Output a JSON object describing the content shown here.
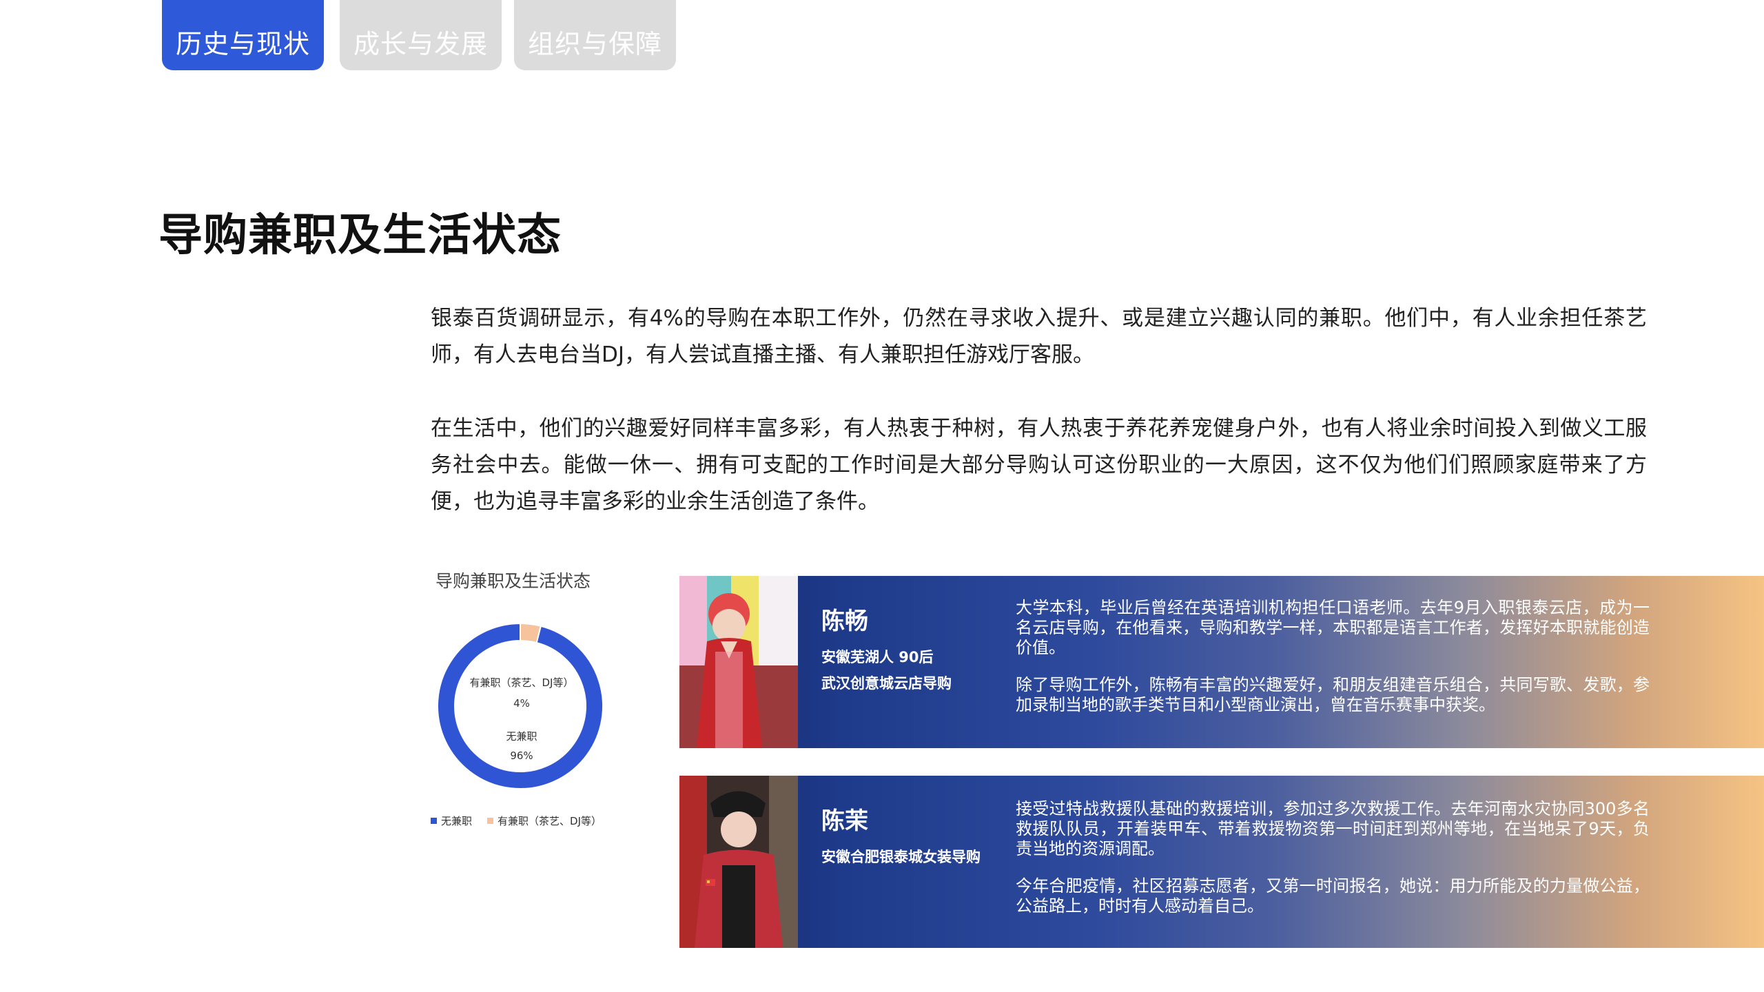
{
  "tabs": [
    {
      "label": "历史与现状",
      "active": true
    },
    {
      "label": "成长与发展",
      "active": false
    },
    {
      "label": "组织与保障",
      "active": false
    }
  ],
  "page_title": "导购兼职及生活状态",
  "paragraphs": [
    "银泰百货调研显示，有4%的导购在本职工作外，仍然在寻求收入提升、或是建立兴趣认同的兼职。他们中，有人业余担任茶艺师，有人去电台当DJ，有人尝试直播主播、有人兼职担任游戏厅客服。",
    "在生活中，他们的兴趣爱好同样丰富多彩，有人热衷于种树，有人热衷于养花养宠健身户外，也有人将业余时间投入到做义工服务社会中去。能做一休一、拥有可支配的工作时间是大部分导购认可这份职业的一大原因，这不仅为他们们照顾家庭带来了方便，也为追寻丰富多彩的业余生活创造了条件。"
  ],
  "chart_data": {
    "type": "pie",
    "variant": "donut",
    "title": "导购兼职及生活状态",
    "slices": [
      {
        "label": "无兼职",
        "value": 96,
        "value_label": "96%",
        "color": "#2f55d4"
      },
      {
        "label": "有兼职（茶艺、DJ等）",
        "value": 4,
        "value_label": "4%",
        "color": "#f6c39c"
      }
    ],
    "legend": [
      "无兼职",
      "有兼职（茶艺、DJ等）"
    ],
    "legend_position": "bottom"
  },
  "profiles": [
    {
      "name": "陈畅",
      "meta": [
        "安徽芜湖人 90后",
        "武汉创意城云店导购"
      ],
      "desc": [
        "大学本科，毕业后曾经在英语培训机构担任口语老师。去年9月入职银泰云店，成为一名云店导购，在他看来，导购和教学一样，本职都是语言工作者，发挥好本职就能创造价值。",
        "除了导购工作外，陈畅有丰富的兴趣爱好，和朋友组建音乐组合，共同写歌、发歌，参加录制当地的歌手类节目和小型商业演出，曾在音乐赛事中获奖。"
      ]
    },
    {
      "name": "陈茉",
      "meta": [
        "安徽合肥银泰城女装导购"
      ],
      "desc": [
        "接受过特战救援队基础的救援培训，参加过多次救援工作。去年河南水灾协同300多名救援队队员，开着装甲车、带着救援物资第一时间赶到郑州等地，在当地呆了9天，负责当地的资源调配。",
        "今年合肥疫情，社区招募志愿者，又第一时间报名，她说：用力所能及的力量做公益，公益路上，时时有人感动着自己。"
      ]
    }
  ]
}
